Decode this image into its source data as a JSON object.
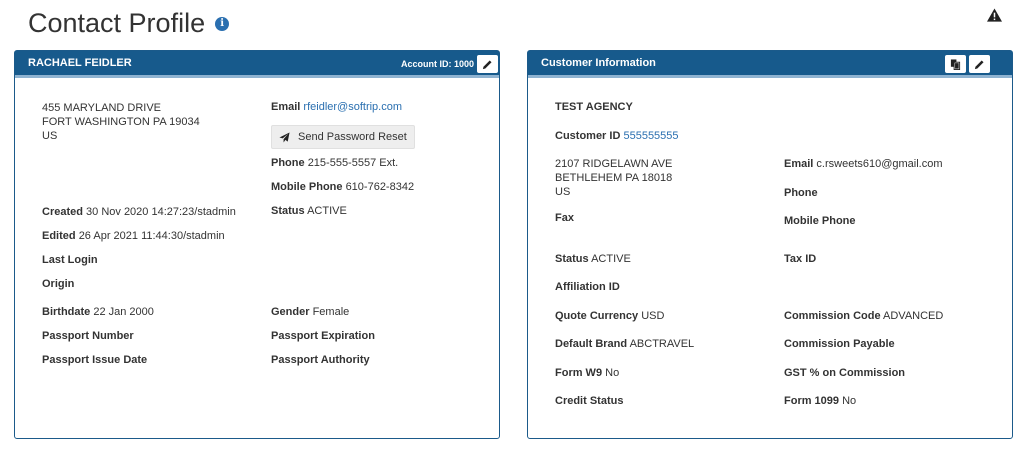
{
  "page": {
    "title": "Contact Profile"
  },
  "contact": {
    "name": "RACHAEL FEIDLER",
    "account_id": "Account ID: 1000",
    "address": [
      "455 MARYLAND DRIVE",
      "FORT WASHINGTON PA 19034",
      "US"
    ],
    "email": {
      "label": "Email",
      "value": "rfeidler@softrip.com"
    },
    "send_password_reset": "Send Password Reset",
    "phone": {
      "label": "Phone",
      "value": "215-555-5557 Ext."
    },
    "mobile_phone": {
      "label": "Mobile Phone",
      "value": "610-762-8342"
    },
    "created": {
      "label": "Created",
      "value": "30 Nov 2020 14:27:23/stadmin"
    },
    "status": {
      "label": "Status",
      "value": "ACTIVE"
    },
    "edited": {
      "label": "Edited",
      "value": "26 Apr 2021 11:44:30/stadmin"
    },
    "last_login": {
      "label": "Last Login",
      "value": ""
    },
    "origin": {
      "label": "Origin",
      "value": ""
    },
    "birthdate": {
      "label": "Birthdate",
      "value": "22 Jan 2000"
    },
    "gender": {
      "label": "Gender",
      "value": "Female"
    },
    "passport_number": {
      "label": "Passport Number",
      "value": ""
    },
    "passport_expiration": {
      "label": "Passport Expiration",
      "value": ""
    },
    "passport_issue_date": {
      "label": "Passport Issue Date",
      "value": ""
    },
    "passport_authority": {
      "label": "Passport Authority",
      "value": ""
    }
  },
  "customer": {
    "title": "Customer Information",
    "agency": "TEST AGENCY",
    "customer_id": {
      "label": "Customer ID",
      "value": "555555555"
    },
    "address": [
      "2107 RIDGELAWN AVE",
      "BETHLEHEM PA 18018",
      "US"
    ],
    "email": {
      "label": "Email",
      "value": "c.rsweets610@gmail.com"
    },
    "phone": {
      "label": "Phone",
      "value": ""
    },
    "fax": {
      "label": "Fax",
      "value": ""
    },
    "mobile_phone": {
      "label": "Mobile Phone",
      "value": ""
    },
    "status": {
      "label": "Status",
      "value": "ACTIVE"
    },
    "tax_id": {
      "label": "Tax ID",
      "value": ""
    },
    "affiliation_id": {
      "label": "Affiliation ID",
      "value": ""
    },
    "quote_currency": {
      "label": "Quote Currency",
      "value": "USD"
    },
    "commission_code": {
      "label": "Commission Code",
      "value": "ADVANCED"
    },
    "default_brand": {
      "label": "Default Brand",
      "value": "ABCTRAVEL"
    },
    "commission_payable": {
      "label": "Commission Payable",
      "value": ""
    },
    "form_w9": {
      "label": "Form W9",
      "value": "No"
    },
    "gst_on_commission": {
      "label": "GST % on Commission",
      "value": ""
    },
    "credit_status": {
      "label": "Credit Status",
      "value": ""
    },
    "form_1099": {
      "label": "Form 1099",
      "value": "No"
    }
  },
  "icons": {
    "info": "info-icon",
    "warning": "warning-icon",
    "edit": "pencil-icon",
    "copy": "copy-icon",
    "send": "paper-plane-icon"
  },
  "colors": {
    "header": "#175a8c",
    "link": "#2a6fb0",
    "info": "#2a6fb0"
  }
}
